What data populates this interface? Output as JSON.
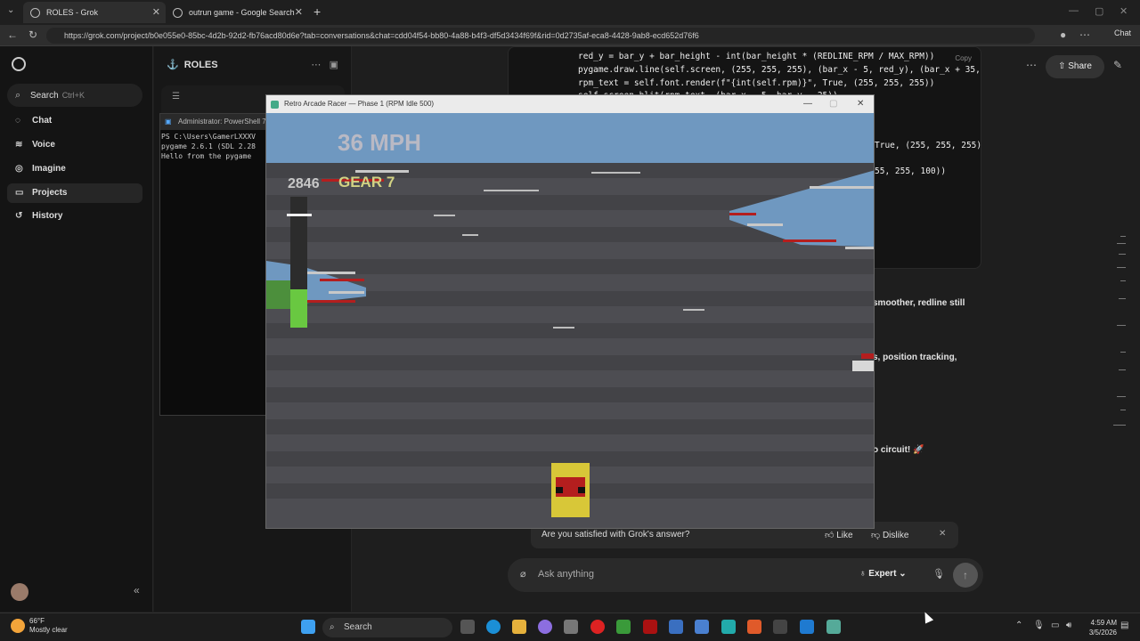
{
  "browser": {
    "tabs": [
      {
        "label": "ROLES - Grok",
        "active": true
      },
      {
        "label": "outrun game - Google Search",
        "active": false
      }
    ],
    "url": "https://grok.com/project/b0e055e0-85bc-4d2b-92d2-fb76acd80d6e?tab=conversations&chat=cdd04f54-bb80-4a88-b4f3-df5d3434f69f&rid=0d2735af-eca8-4428-9ab8-ecd652d76f6",
    "chat_button": "Chat"
  },
  "sidebar": {
    "search_label": "Search",
    "search_shortcut": "Ctrl+K",
    "items": [
      {
        "label": "Chat",
        "icon": "chat-bubble-icon"
      },
      {
        "label": "Voice",
        "icon": "waveform-icon"
      },
      {
        "label": "Imagine",
        "icon": "image-icon"
      },
      {
        "label": "Projects",
        "icon": "folder-icon"
      },
      {
        "label": "History",
        "icon": "history-icon"
      }
    ]
  },
  "project": {
    "title": "ROLES"
  },
  "powershell": {
    "title": "Administrator: PowerShell 7",
    "lines": [
      "PS C:\\Users\\GamerLXXXV",
      "pygame 2.6.1 (SDL 2.28",
      "Hello from the pygame"
    ]
  },
  "code": {
    "copy_label": "Copy",
    "lines": [
      "red_y = bar_y + bar_height - int(bar_height * (REDLINE_RPM / MAX_RPM))",
      "pygame.draw.line(self.screen, (255, 255, 255), (bar_x - 5, red_y), (bar_x + 35,",
      "rpm_text = self.font.render(f\"{int(self.rpm)}\", True, (255, 255, 255))",
      "self.screen.blit(rpm_text, (bar_x - 5, bar_y - 25))"
    ],
    "fragment_1": "True, (255, 255, 255))",
    "fragment_2": "55, 255, 100))"
  },
  "chat": {
    "share_label": "Share",
    "text_fragments": [
      "smoother, redline still",
      "s, position tracking,",
      "o circuit! 🚀"
    ],
    "feedback_question": "Are you satisfied with Grok's answer?",
    "like_label": "Like",
    "dislike_label": "Dislike",
    "input_placeholder": "Ask anything",
    "mode_label": "Expert"
  },
  "game": {
    "window_title": "Retro Arcade Racer — Phase 1 (RPM Idle 500)",
    "speed_text": "36 MPH",
    "gear_text": "GEAR 7",
    "rpm_text": "2846",
    "rpm_fill_fraction": 0.29,
    "colors": {
      "sky": "#6f98c0",
      "road": "#4d4d52",
      "stripe": "#434347",
      "car_body": "#b41e1e",
      "car_frame": "#d8c738",
      "rpm_fill": "#69c841"
    }
  },
  "taskbar": {
    "weather_temp": "66°F",
    "weather_desc": "Mostly clear",
    "search_label": "Search",
    "time": "4:59 AM",
    "date": "3/5/2026"
  }
}
